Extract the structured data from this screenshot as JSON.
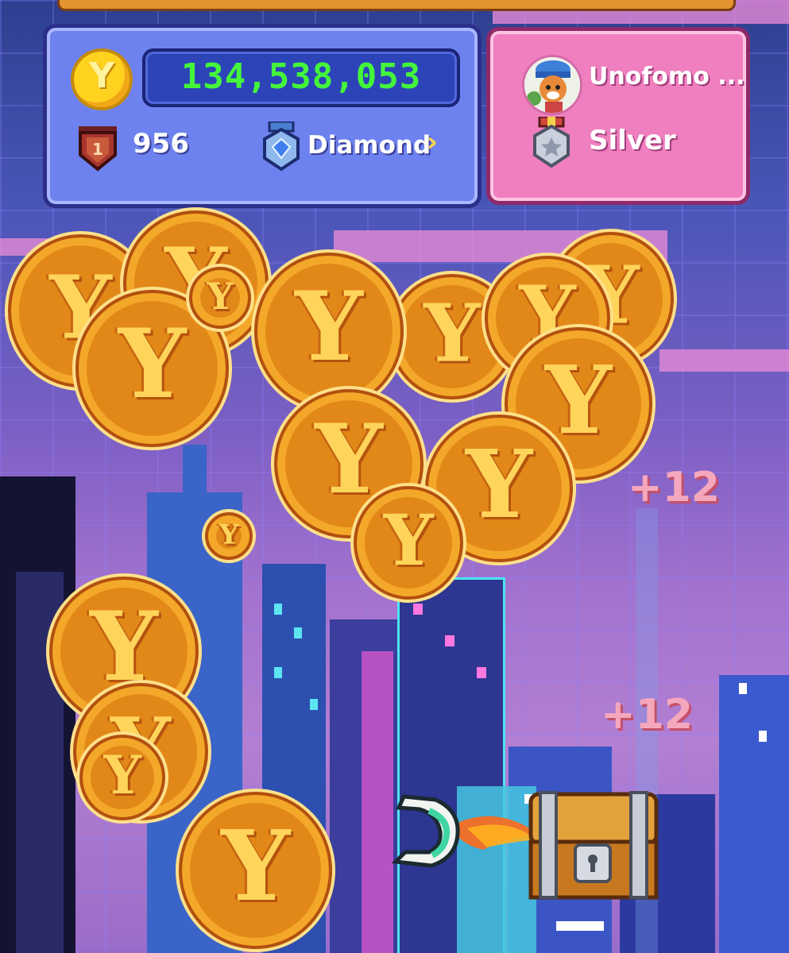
{
  "header": {
    "balance": "134,538,053",
    "level": "956",
    "league": "Diamond",
    "league_chevron": "›"
  },
  "profile": {
    "username": "Unofomo ...",
    "rank": "Silver"
  },
  "bonus_popups": [
    "+12",
    "+12"
  ],
  "coin_symbol": "Y",
  "icons": [
    "coin-icon",
    "level-badge-icon",
    "diamond-medal-icon",
    "silver-medal-icon",
    "avatar",
    "claw-icon",
    "treasure-chest-icon"
  ],
  "colors": {
    "balance_text": "#44f53c",
    "stats_panel": "#6d82ee",
    "profile_panel": "#f07fbf",
    "coin": "#e28818"
  }
}
